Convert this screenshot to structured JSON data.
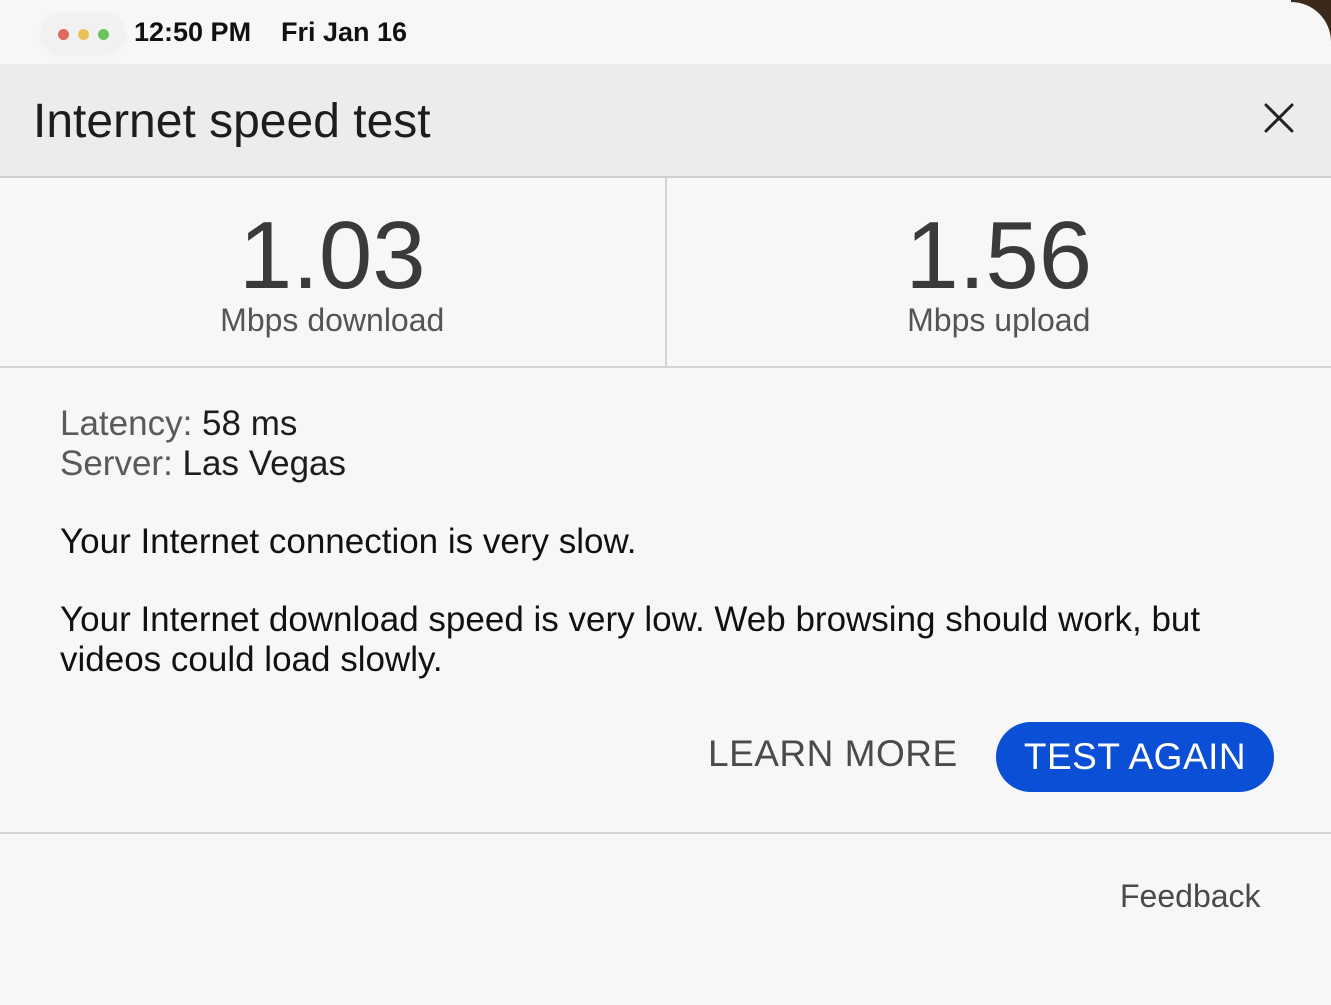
{
  "status_bar": {
    "time": "12:50 PM",
    "date": "Fri Jan 16",
    "dots": [
      "#e0685f",
      "#e8c15a",
      "#6cc35c"
    ]
  },
  "header": {
    "title": "Internet speed test",
    "close_icon": "close-icon"
  },
  "results": {
    "download": {
      "value": "1.03",
      "unit": "Mbps download"
    },
    "upload": {
      "value": "1.56",
      "unit": "Mbps upload"
    }
  },
  "details": {
    "latency_label": "Latency:",
    "latency_value": "58 ms",
    "server_label": "Server:",
    "server_value": "Las Vegas",
    "summary": "Your Internet connection is very slow.",
    "detail": "Your Internet download speed is very low. Web browsing should work, but videos could load slowly."
  },
  "actions": {
    "learn_more": "LEARN MORE",
    "test_again": "TEST AGAIN"
  },
  "footer": {
    "feedback": "Feedback"
  },
  "colors": {
    "accent": "#0b4fd6",
    "header_bg": "#ececee",
    "page_bg": "#f7f7f7"
  }
}
